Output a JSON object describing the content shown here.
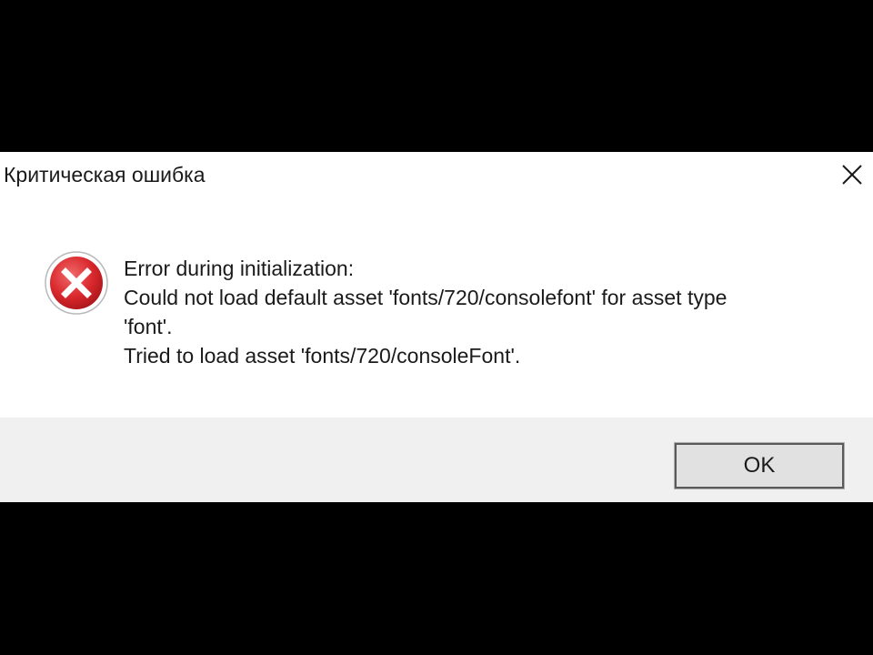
{
  "window": {
    "title": "Критическая ошибка",
    "close_icon": "close-icon"
  },
  "message": {
    "icon": "error-icon",
    "lines": [
      "Error during initialization:",
      "Could not load default asset 'fonts/720/consolefont' for asset type",
      "'font'.",
      "Tried to load asset 'fonts/720/consoleFont'."
    ]
  },
  "buttons": {
    "ok_label": "OK"
  },
  "colors": {
    "error_red": "#d9282d",
    "dialog_bg": "#ffffff",
    "footer_bg": "#f0f0f0",
    "screen_bg": "#000000"
  }
}
